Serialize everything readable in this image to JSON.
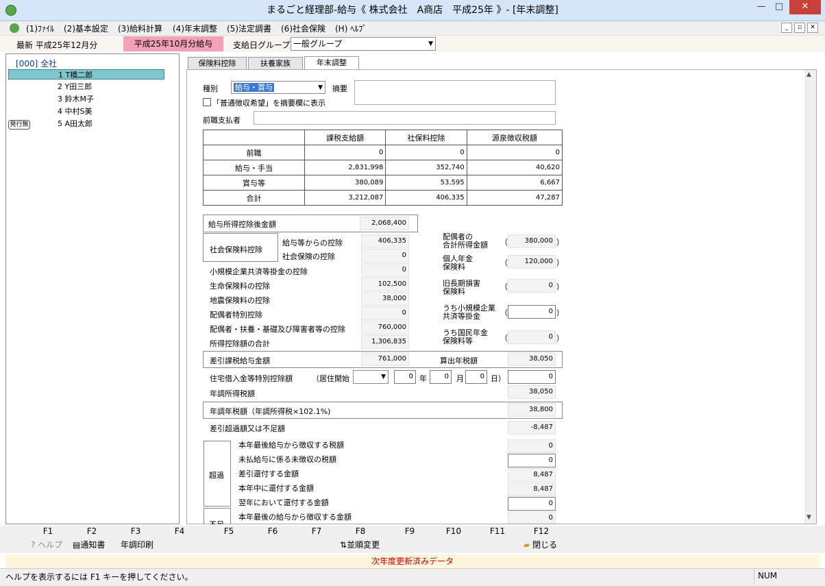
{
  "window": {
    "title": "まるごと経理部-給与《 株式会社　A商店　平成25年 》- [年末調整]",
    "min": "—",
    "max": "□",
    "close": "✕"
  },
  "menu": [
    "(1)ﾌｧｲﾙ",
    "(2)基本設定",
    "(3)給料計算",
    "(4)年末調整",
    "(5)法定調書",
    "(6)社会保険",
    "(H) ﾍﾙﾌﾟ"
  ],
  "mdi": {
    "min": "_",
    "restore": "▫",
    "close": "✕"
  },
  "info": {
    "latest": "最新  平成25年12月分",
    "badge": "平成25年10月分給与",
    "group_label": "支給日グループ",
    "group_value": "一般グループ"
  },
  "tree": {
    "root": "[000] 全社",
    "employees": [
      {
        "num": "1",
        "name": "T橋二郎"
      },
      {
        "num": "2",
        "name": "Y田三郎"
      },
      {
        "num": "3",
        "name": "鈴木M子"
      },
      {
        "num": "4",
        "name": "中村S美"
      },
      {
        "num": "5",
        "name": "A田太郎"
      }
    ],
    "badge": "発行無"
  },
  "tabs": [
    "保険料控除",
    "扶養家族",
    "年末調整"
  ],
  "form": {
    "kind_label": "種別",
    "kind_value": "給与・賞与",
    "memo_label": "摘要",
    "checkbox_label": "「普通徴収希望」を摘要欄に表示",
    "prev_payer_label": "前職支払者",
    "table": {
      "headers": [
        "課税支給額",
        "社保料控除",
        "源泉徴収税額"
      ],
      "rows": [
        {
          "label": "前職",
          "values": [
            "0",
            "0",
            "0"
          ]
        },
        {
          "label": "給与・手当",
          "values": [
            "2,831,998",
            "352,740",
            "40,620"
          ]
        },
        {
          "label": "賞与等",
          "values": [
            "380,089",
            "53,595",
            "6,667"
          ]
        },
        {
          "label": "合計",
          "values": [
            "3,212,087",
            "406,335",
            "47,287"
          ]
        }
      ]
    },
    "after_deduction": {
      "label": "給与所得控除後金額",
      "value": "2,068,400"
    },
    "social_label": "社会保険料控除",
    "deductions": [
      {
        "label": "給与等からの控除",
        "value": "406,335"
      },
      {
        "label": "社会保険の控除",
        "value": "0"
      },
      {
        "label": "小規模企業共済等掛金の控除",
        "value": "0"
      },
      {
        "label": "生命保険料の控除",
        "value": "102,500"
      },
      {
        "label": "地震保険料の控除",
        "value": "38,000"
      },
      {
        "label": "配偶者特別控除",
        "value": "0"
      },
      {
        "label": "配偶者・扶養・基礎及び障害者等の控除",
        "value": "760,000"
      },
      {
        "label": "所得控除額の合計",
        "value": "1,306,835"
      }
    ],
    "right": [
      {
        "label1": "配偶者の",
        "label2": "合計所得金額",
        "value": "380,000"
      },
      {
        "label1": "個人年金",
        "label2": "保険料",
        "value": "120,000"
      },
      {
        "label1": "旧長期損害",
        "label2": "保険料",
        "value": "0"
      },
      {
        "label1": "うち小規模企業",
        "label2": "共済等掛金",
        "value": "0"
      },
      {
        "label1": "うち国民年金",
        "label2": "保険料等",
        "value": "0"
      }
    ],
    "paren_open": "（",
    "paren_close": "）",
    "taxable": {
      "label": "差引課税給与金額",
      "value": "761,000",
      "calc_label": "算出年税額",
      "calc_value": "38,050"
    },
    "housing": {
      "label": "住宅借入金等特別控除額",
      "start_label": "（居住開始",
      "year": "0",
      "year_unit": "年",
      "month": "0",
      "month_unit": "月",
      "day": "0",
      "day_unit": "日）",
      "value": "0"
    },
    "annual_income_tax": {
      "label": "年調所得税額",
      "value": "38,050"
    },
    "annual_tax": {
      "label": "年調年税額（年調所得税×102.1%)",
      "value": "38,800"
    },
    "diff": {
      "label": "差引超過額又は不足額",
      "value": "-8,487"
    },
    "excess_label": "超過",
    "excess": [
      {
        "label": "本年最後給与から徴収する税額",
        "value": "0"
      },
      {
        "label": "未払給与に係る未徴収の税額",
        "value": "0"
      },
      {
        "label": "差引還付する金額",
        "value": "8,487"
      },
      {
        "label": "本年中に還付する金額",
        "value": "8,487"
      },
      {
        "label": "翌年において還付する金額",
        "value": "0"
      },
      {
        "label": "本年最後の給与から徴収する金額",
        "value": "0"
      }
    ],
    "short_label": "不足"
  },
  "fkeys": [
    "F1",
    "F2",
    "F3",
    "F4",
    "F5",
    "F6",
    "F7",
    "F8",
    "F9",
    "F10",
    "F11",
    "F12"
  ],
  "factions": {
    "help": "ヘルプ",
    "notice": "通知書",
    "print": "年調印刷",
    "sort": "並順変更",
    "close": "閉じる"
  },
  "notice": "次年度更新済みデータ",
  "status": {
    "hint": "ヘルプを表示するには F1 キーを押してください。",
    "num": "NUM"
  }
}
